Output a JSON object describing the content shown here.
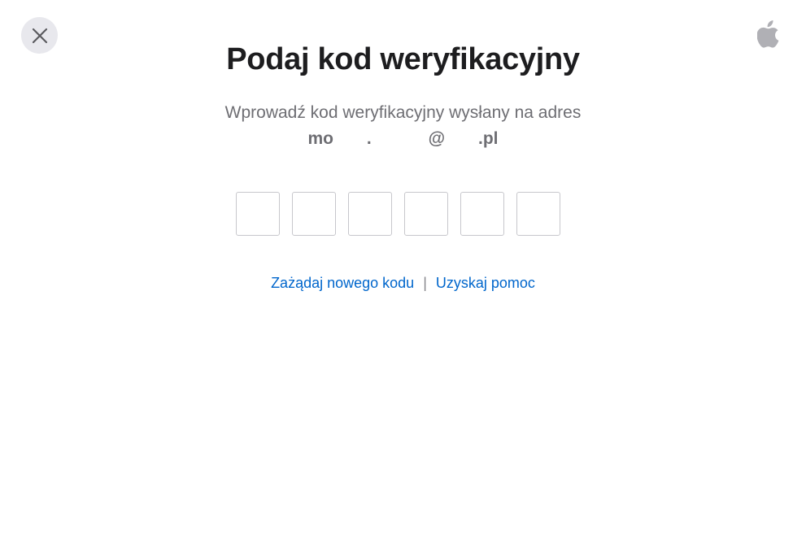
{
  "close_button": {
    "icon": "close-icon"
  },
  "logo": {
    "icon": "apple-logo-icon"
  },
  "title": "Podaj kod weryfikacyjny",
  "subtitle": "Wprowadź kod weryfikacyjny wysłany na adres",
  "email": "mo       .            @       .pl",
  "code_inputs": [
    "",
    "",
    "",
    "",
    "",
    ""
  ],
  "links": {
    "request_new_code": "Zażądaj nowego kodu",
    "separator": "|",
    "get_help": "Uzyskaj pomoc"
  },
  "colors": {
    "link": "#0066cc",
    "title": "#1d1d1f",
    "subtitle": "#6e6e73",
    "close_bg": "#e8e8ed"
  }
}
